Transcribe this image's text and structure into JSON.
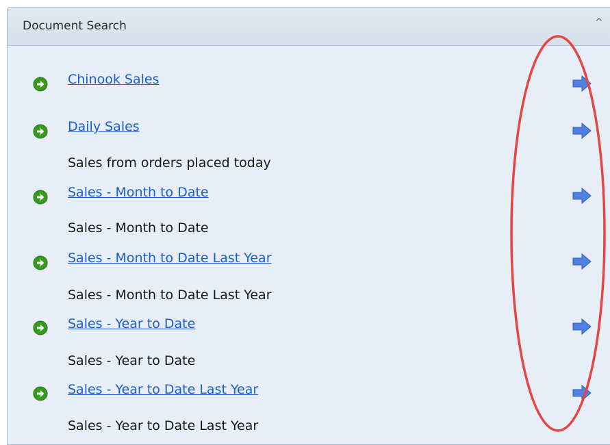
{
  "panel": {
    "title": "Document Search",
    "collapse_glyph": "^"
  },
  "documents": [
    {
      "title": "Chinook Sales",
      "description": ""
    },
    {
      "title": "Daily Sales",
      "description": "Sales from orders placed today"
    },
    {
      "title": "Sales - Month to Date",
      "description": "Sales - Month to Date"
    },
    {
      "title": "Sales - Month to Date Last Year",
      "description": "Sales - Month to Date Last Year"
    },
    {
      "title": "Sales - Year to Date",
      "description": "Sales - Year to Date"
    },
    {
      "title": "Sales - Year to Date Last Year",
      "description": "Sales - Year to Date Last Year"
    }
  ],
  "icons": {
    "go": "green-circle-arrow-icon",
    "open": "blue-arrow-icon",
    "collapse": "caret-up-icon"
  },
  "colors": {
    "link": "#1a5fd0",
    "go_icon": "#3a9a1e",
    "open_arrow": "#4f7fe0",
    "annotation": "#e64545",
    "panel_bg": "#e8eef7"
  }
}
